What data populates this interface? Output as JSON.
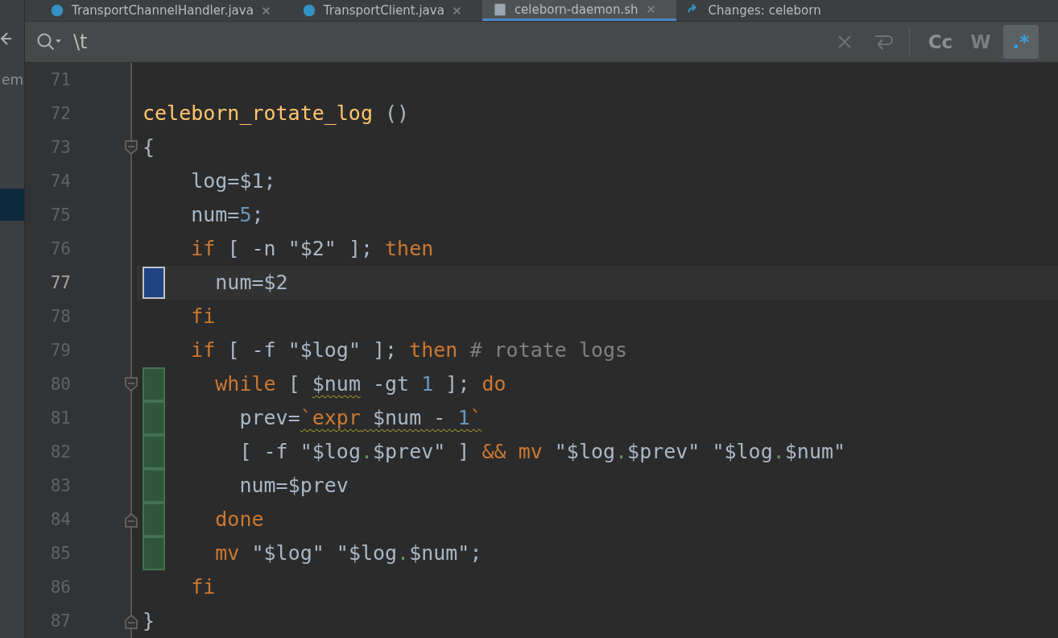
{
  "tabs": [
    {
      "label": "TransportChannelHandler.java",
      "kind": "class",
      "selected": false
    },
    {
      "label": "TransportClient.java",
      "kind": "class",
      "selected": false
    },
    {
      "label": "celeborn-daemon.sh",
      "kind": "file",
      "selected": true
    },
    {
      "label": "Changes: celeborn",
      "kind": "changes",
      "selected": false
    }
  ],
  "sidebar": {
    "rows": [
      {
        "label": "em",
        "selected": false
      },
      {
        "selected": true
      }
    ]
  },
  "search": {
    "value": "\\t",
    "options": [
      {
        "label": "Cc",
        "selected": false,
        "disabled": false
      },
      {
        "label": "W",
        "selected": false,
        "disabled": true
      },
      {
        "label": ".*",
        "selected": true,
        "disabled": false
      }
    ]
  },
  "lines": [
    {
      "number": "71",
      "current": false,
      "modified": false,
      "added": false,
      "fold_start": false,
      "fold_end": false
    },
    {
      "number": "72",
      "current": false,
      "modified": false,
      "added": false,
      "fold_start": false,
      "fold_end": false,
      "tokens": [
        {
          "text": "celeborn_rotate_log",
          "kind": "function",
          "warn": false
        },
        {
          "text": " ()",
          "kind": "plain",
          "warn": false
        }
      ]
    },
    {
      "number": "73",
      "current": false,
      "modified": false,
      "added": false,
      "fold_start": true,
      "fold_end": false,
      "tokens": [
        {
          "text": "{",
          "kind": "plain",
          "warn": false
        }
      ]
    },
    {
      "number": "74",
      "current": false,
      "modified": false,
      "added": false,
      "fold_start": false,
      "fold_end": false,
      "tokens": [
        {
          "text": "    log=$1;",
          "kind": "plain",
          "warn": false
        }
      ]
    },
    {
      "number": "75",
      "current": false,
      "modified": false,
      "added": false,
      "fold_start": false,
      "fold_end": false,
      "tokens": [
        {
          "text": "    num=",
          "kind": "plain",
          "warn": false
        },
        {
          "text": "5",
          "kind": "number",
          "warn": false
        },
        {
          "text": ";",
          "kind": "plain",
          "warn": false
        }
      ]
    },
    {
      "number": "76",
      "current": false,
      "modified": false,
      "added": false,
      "fold_start": false,
      "fold_end": false,
      "tokens": [
        {
          "text": "    if",
          "kind": "keyword",
          "warn": false
        },
        {
          "text": " [ -n \"$2\" ]; ",
          "kind": "plain",
          "warn": false
        },
        {
          "text": "then",
          "kind": "keyword",
          "warn": false
        }
      ]
    },
    {
      "number": "77",
      "current": true,
      "modified": true,
      "added": false,
      "fold_start": false,
      "fold_end": false,
      "tokens": [
        {
          "text": "      num=$2",
          "kind": "plain",
          "warn": false
        }
      ]
    },
    {
      "number": "78",
      "current": false,
      "modified": false,
      "added": false,
      "fold_start": false,
      "fold_end": false,
      "tokens": [
        {
          "text": "    fi",
          "kind": "keyword",
          "warn": false
        }
      ]
    },
    {
      "number": "79",
      "current": false,
      "modified": false,
      "added": false,
      "fold_start": false,
      "fold_end": false,
      "tokens": [
        {
          "text": "    if",
          "kind": "keyword",
          "warn": false
        },
        {
          "text": " [ -f \"$log\" ]; ",
          "kind": "plain",
          "warn": false
        },
        {
          "text": "then",
          "kind": "keyword",
          "warn": false
        },
        {
          "text": " # rotate logs",
          "kind": "comment",
          "warn": false
        }
      ]
    },
    {
      "number": "80",
      "current": false,
      "modified": false,
      "added": true,
      "fold_start": true,
      "fold_end": false,
      "tokens": [
        {
          "text": "      while",
          "kind": "keyword",
          "warn": false
        },
        {
          "text": " [ ",
          "kind": "plain",
          "warn": false
        },
        {
          "text": "$num",
          "kind": "plain",
          "warn": true
        },
        {
          "text": " -gt ",
          "kind": "plain",
          "warn": false
        },
        {
          "text": "1",
          "kind": "number",
          "warn": false
        },
        {
          "text": " ]; ",
          "kind": "plain",
          "warn": false
        },
        {
          "text": "do",
          "kind": "keyword",
          "warn": false
        }
      ]
    },
    {
      "number": "81",
      "current": false,
      "modified": false,
      "added": true,
      "fold_start": false,
      "fold_end": false,
      "tokens": [
        {
          "text": "        prev=",
          "kind": "plain",
          "warn": false
        },
        {
          "text": "`",
          "kind": "keyword",
          "warn": true
        },
        {
          "text": "expr",
          "kind": "keyword",
          "warn": true
        },
        {
          "text": " $num - ",
          "kind": "plain",
          "warn": true
        },
        {
          "text": "1",
          "kind": "number",
          "warn": true
        },
        {
          "text": "`",
          "kind": "keyword",
          "warn": true
        }
      ]
    },
    {
      "number": "82",
      "current": false,
      "modified": false,
      "added": true,
      "fold_start": false,
      "fold_end": false,
      "tokens": [
        {
          "text": "        [ -f \"$log",
          "kind": "plain",
          "warn": false
        },
        {
          "text": ".",
          "kind": "dot",
          "warn": false
        },
        {
          "text": "$prev\" ] ",
          "kind": "plain",
          "warn": false
        },
        {
          "text": "&&",
          "kind": "keyword",
          "warn": false
        },
        {
          "text": " mv",
          "kind": "keyword",
          "warn": false
        },
        {
          "text": " \"$log",
          "kind": "plain",
          "warn": false
        },
        {
          "text": ".",
          "kind": "dot",
          "warn": false
        },
        {
          "text": "$prev\" \"$log",
          "kind": "plain",
          "warn": false
        },
        {
          "text": ".",
          "kind": "dot",
          "warn": false
        },
        {
          "text": "$num\"",
          "kind": "plain",
          "warn": false
        }
      ]
    },
    {
      "number": "83",
      "current": false,
      "modified": false,
      "added": true,
      "fold_start": false,
      "fold_end": false,
      "tokens": [
        {
          "text": "        num=$prev",
          "kind": "plain",
          "warn": false
        }
      ]
    },
    {
      "number": "84",
      "current": false,
      "modified": false,
      "added": true,
      "fold_start": false,
      "fold_end": true,
      "tokens": [
        {
          "text": "      done",
          "kind": "keyword",
          "warn": false
        }
      ]
    },
    {
      "number": "85",
      "current": false,
      "modified": false,
      "added": true,
      "fold_start": false,
      "fold_end": false,
      "tokens": [
        {
          "text": "      mv",
          "kind": "keyword",
          "warn": false
        },
        {
          "text": " \"$log\" \"$log",
          "kind": "plain",
          "warn": false
        },
        {
          "text": ".",
          "kind": "dot",
          "warn": false
        },
        {
          "text": "$num\";",
          "kind": "plain",
          "warn": false
        }
      ]
    },
    {
      "number": "86",
      "current": false,
      "modified": false,
      "added": false,
      "fold_start": false,
      "fold_end": false,
      "tokens": [
        {
          "text": "    fi",
          "kind": "keyword",
          "warn": false
        }
      ]
    },
    {
      "number": "87",
      "current": false,
      "modified": false,
      "added": false,
      "fold_start": false,
      "fold_end": true,
      "tokens": [
        {
          "text": "}",
          "kind": "plain",
          "warn": false
        }
      ]
    }
  ]
}
